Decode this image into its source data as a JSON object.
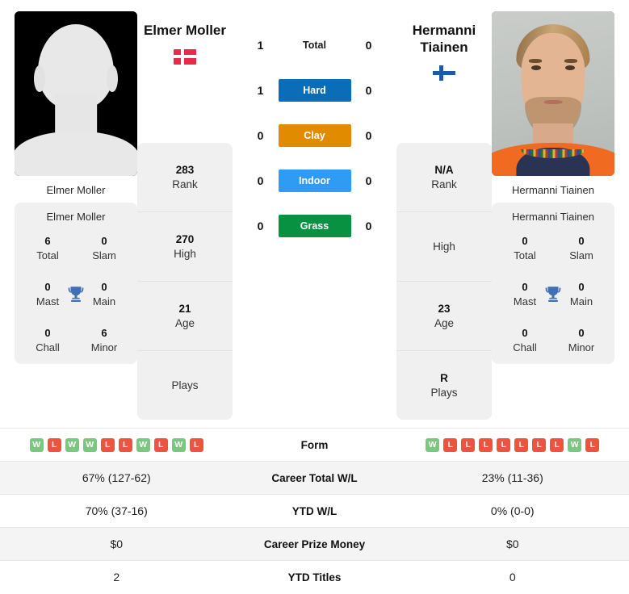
{
  "players": {
    "left": {
      "name": "Elmer Moller",
      "name_display": "Elmer Moller",
      "caption": "Elmer Moller",
      "flag": "denmark-flag",
      "flag_country": "Denmark",
      "photo": "silhouette-placeholder",
      "info": [
        {
          "value": "283",
          "label": "Rank"
        },
        {
          "value": "270",
          "label": "High"
        },
        {
          "value": "21",
          "label": "Age"
        },
        {
          "value": "",
          "label": "Plays"
        }
      ],
      "titles": [
        {
          "value": "6",
          "label": "Total"
        },
        {
          "value": "0",
          "label": "Slam"
        },
        {
          "value": "0",
          "label": "Mast"
        },
        {
          "value": "0",
          "label": "Main"
        },
        {
          "value": "0",
          "label": "Chall"
        },
        {
          "value": "6",
          "label": "Minor"
        }
      ],
      "surface_wins": {
        "total": "1",
        "hard": "1",
        "clay": "0",
        "indoor": "0",
        "grass": "0"
      },
      "form": [
        "W",
        "L",
        "W",
        "W",
        "L",
        "L",
        "W",
        "L",
        "W",
        "L"
      ],
      "career_total_wl": "67% (127-62)",
      "ytd_wl": "70% (37-16)",
      "career_prize_money": "$0",
      "ytd_titles": "2"
    },
    "right": {
      "name": "Hermanni Tiainen",
      "name_display": "Hermanni\nTiainen",
      "caption": "Hermanni Tiainen",
      "flag": "finland-flag",
      "flag_country": "Finland",
      "photo": "player-portrait",
      "info": [
        {
          "value": "N/A",
          "label": "Rank"
        },
        {
          "value": "",
          "label": "High"
        },
        {
          "value": "23",
          "label": "Age"
        },
        {
          "value": "R",
          "label": "Plays"
        }
      ],
      "titles": [
        {
          "value": "0",
          "label": "Total"
        },
        {
          "value": "0",
          "label": "Slam"
        },
        {
          "value": "0",
          "label": "Mast"
        },
        {
          "value": "0",
          "label": "Main"
        },
        {
          "value": "0",
          "label": "Chall"
        },
        {
          "value": "0",
          "label": "Minor"
        }
      ],
      "surface_wins": {
        "total": "0",
        "hard": "0",
        "clay": "0",
        "indoor": "0",
        "grass": "0"
      },
      "form": [
        "W",
        "L",
        "L",
        "L",
        "L",
        "L",
        "L",
        "L",
        "W",
        "L"
      ],
      "career_total_wl": "23% (11-36)",
      "ytd_wl": "0% (0-0)",
      "career_prize_money": "$0",
      "ytd_titles": "0"
    }
  },
  "surfaces": [
    {
      "key": "total",
      "label": "Total",
      "color": "",
      "plain": true
    },
    {
      "key": "hard",
      "label": "Hard",
      "color": "#0b6cb8",
      "plain": false
    },
    {
      "key": "clay",
      "label": "Clay",
      "color": "#e08b00",
      "plain": false
    },
    {
      "key": "indoor",
      "label": "Indoor",
      "color": "#2f9bf5",
      "plain": false
    },
    {
      "key": "grass",
      "label": "Grass",
      "color": "#089140",
      "plain": false
    }
  ],
  "table_rows": [
    {
      "label": "Form",
      "type": "form"
    },
    {
      "label": "Career Total W/L",
      "type": "text",
      "field": "career_total_wl"
    },
    {
      "label": "YTD W/L",
      "type": "text",
      "field": "ytd_wl"
    },
    {
      "label": "Career Prize Money",
      "type": "text",
      "field": "career_prize_money"
    },
    {
      "label": "YTD Titles",
      "type": "text",
      "field": "ytd_titles"
    }
  ],
  "colors": {
    "win_badge": "#7ac77f",
    "loss_badge": "#ef5340",
    "trophy": "#3f6fb5",
    "card_bg": "#f0f0f0",
    "row_alt_bg": "#f4f4f4"
  },
  "icons": {
    "trophy": "trophy-icon"
  }
}
